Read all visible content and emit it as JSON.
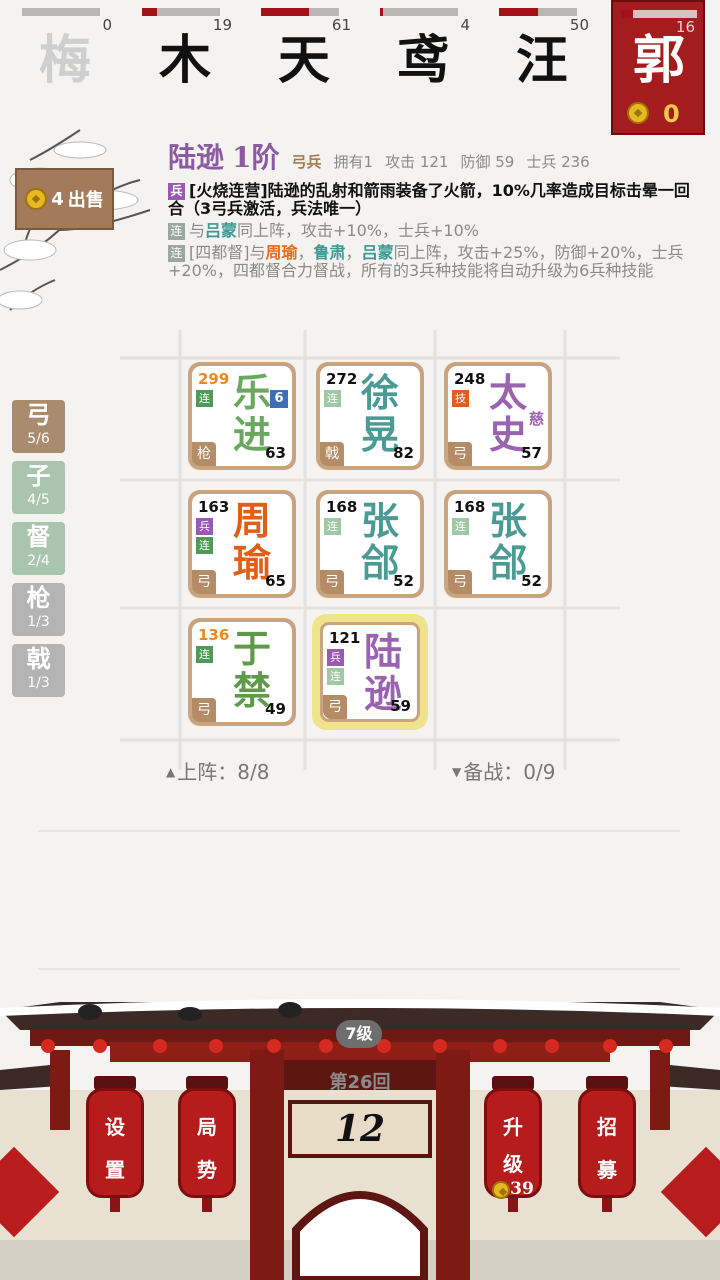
{
  "players": [
    {
      "name": "梅",
      "hp": "0",
      "fill": 0.0,
      "dim": true
    },
    {
      "name": "木",
      "hp": "19",
      "fill": 0.19,
      "dim": false
    },
    {
      "name": "天",
      "hp": "61",
      "fill": 0.61,
      "dim": false
    },
    {
      "name": "鸢",
      "hp": "4",
      "fill": 0.04,
      "dim": false
    },
    {
      "name": "汪",
      "hp": "50",
      "fill": 0.5,
      "dim": false
    },
    {
      "name": "郭",
      "hp": "16",
      "fill": 0.16,
      "dim": false,
      "active": true,
      "gold": "0"
    }
  ],
  "sell": {
    "price": "4",
    "label": "出售"
  },
  "hero": {
    "name": "陆逊",
    "rank": "1阶",
    "type": "弓兵",
    "owned": "拥有1",
    "attack": "攻击 121",
    "defense": "防御 59",
    "soldiers": "士兵 236",
    "skill1_tag": "兵",
    "skill1": "[火烧连营]陆逊的乱射和箭雨装备了火箭，10%几率造成目标击晕一回合（3弓兵激活，兵法唯一）",
    "skill2_tag": "连",
    "skill2_pre": "与",
    "skill2_hl": "吕蒙",
    "skill2_post": "同上阵，攻击+10%，士兵+10%",
    "skill3_tag": "连",
    "skill3_a": "[四都督]与",
    "skill3_b": "周瑜",
    "skill3_c": "，",
    "skill3_d": "鲁肃",
    "skill3_e": "，",
    "skill3_f": "吕蒙",
    "skill3_g": "同上阵，攻击+25%，防御+20%，士兵+20%，四都督合力督战，所有的3兵种技能将自动升级为6兵种技能"
  },
  "tabs": [
    {
      "name": "弓",
      "count": "5/6",
      "color": "#a98b6d"
    },
    {
      "name": "子",
      "count": "4/5",
      "color": "#a9c5ad"
    },
    {
      "name": "督",
      "count": "2/4",
      "color": "#a9c5ad"
    },
    {
      "name": "枪",
      "count": "1/3",
      "color": "#b4b4b4"
    },
    {
      "name": "戟",
      "count": "1/3",
      "color": "#b4b4b4"
    }
  ],
  "cards": [
    {
      "hp": "299",
      "hp_orange": true,
      "name": "乐进",
      "color": "#6aa860",
      "atk": "63",
      "type": "枪",
      "badges": [
        "连"
      ],
      "extra": "6",
      "extra_box": true
    },
    {
      "hp": "272",
      "name": "徐晃",
      "color": "#4b9a94",
      "atk": "82",
      "type": "戟",
      "badges": [
        "连"
      ],
      "faded": true
    },
    {
      "hp": "248",
      "name": "太史",
      "color": "#9a63b0",
      "atk": "57",
      "type": "弓",
      "badges": [
        "技"
      ],
      "extra": "慈"
    },
    {
      "hp": "163",
      "name": "周瑜",
      "color": "#e25d16",
      "atk": "65",
      "type": "弓",
      "badges": [
        "兵",
        "连"
      ]
    },
    {
      "hp": "168",
      "name": "张郃",
      "color": "#4b9a94",
      "atk": "52",
      "type": "弓",
      "badges": [
        "连"
      ],
      "faded": true
    },
    {
      "hp": "168",
      "name": "张郃",
      "color": "#4b9a94",
      "atk": "52",
      "type": "弓",
      "badges": [
        "连"
      ],
      "faded": true
    },
    {
      "hp": "136",
      "hp_orange": true,
      "name": "于禁",
      "color": "#5e9a4a",
      "atk": "49",
      "type": "弓",
      "badges": [
        "连"
      ]
    },
    {
      "hp": "121",
      "name": "陆逊",
      "color": "#9a63b0",
      "atk": "59",
      "type": "弓",
      "badges": [
        "兵",
        "连"
      ],
      "selected": true
    }
  ],
  "deployed": "上阵：8/8",
  "bench": "备战：0/9",
  "level": "7级",
  "round": "第26回",
  "timer": "12",
  "buttons": {
    "settings": [
      "设",
      "置"
    ],
    "situation": [
      "局",
      "势"
    ],
    "upgrade": [
      "升",
      "级"
    ],
    "upgrade_cost": "39",
    "recruit": [
      "招",
      "募"
    ]
  },
  "colors": {
    "accent_red": "#a51c1f",
    "gold": "#e8b820",
    "wood": "#c9a47e"
  }
}
